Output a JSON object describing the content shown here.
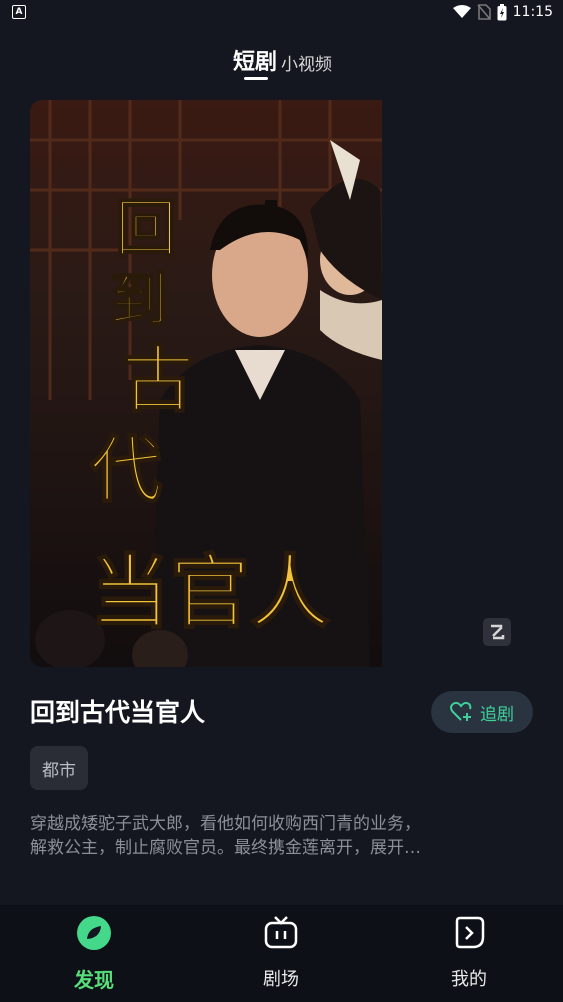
{
  "status": {
    "time": "11:15"
  },
  "tabs": {
    "short_drama": "短剧",
    "short_video": "小视频"
  },
  "drama": {
    "title": "回到古代当官人",
    "follow_label": "追剧",
    "tag": "都市",
    "desc_line1": "穿越成矮驼子武大郎，看他如何收购西门青的业务，",
    "desc_line2": "解救公主，制止腐败官员。最终携金莲离开，展开…",
    "poster_lines": [
      "回",
      "到",
      "古",
      "代",
      "当官人"
    ]
  },
  "nav": {
    "discover": "发现",
    "theater": "剧场",
    "mine": "我的"
  },
  "colors": {
    "accent": "#3ed29a",
    "nav_active": "#55e07a",
    "poster_text": "#f2c33a"
  }
}
